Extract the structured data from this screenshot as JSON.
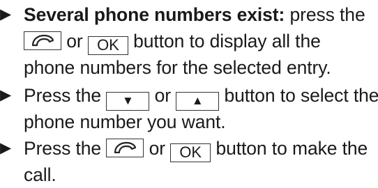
{
  "steps": [
    {
      "bullet": "▶",
      "lead_bold": "Several phone numbers exist:",
      "line1_after": " press the",
      "key_a_icon": "phone-icon",
      "or_text": " or ",
      "key_b_label": "OK",
      "line2_after": " button to display all the",
      "line3": "phone numbers for the selected entry."
    },
    {
      "bullet": "▶",
      "line1_before": "Press the ",
      "key_a_label": "▼",
      "or_text": " or ",
      "key_b_label": "▲",
      "line1_after": " button to select the",
      "line2": "phone number you want."
    },
    {
      "bullet": "▶",
      "line1_before": "Press the ",
      "key_a_icon": "phone-icon",
      "or_text": " or ",
      "key_b_label": "OK",
      "line1_after": " button to make the",
      "line2": "call."
    }
  ]
}
